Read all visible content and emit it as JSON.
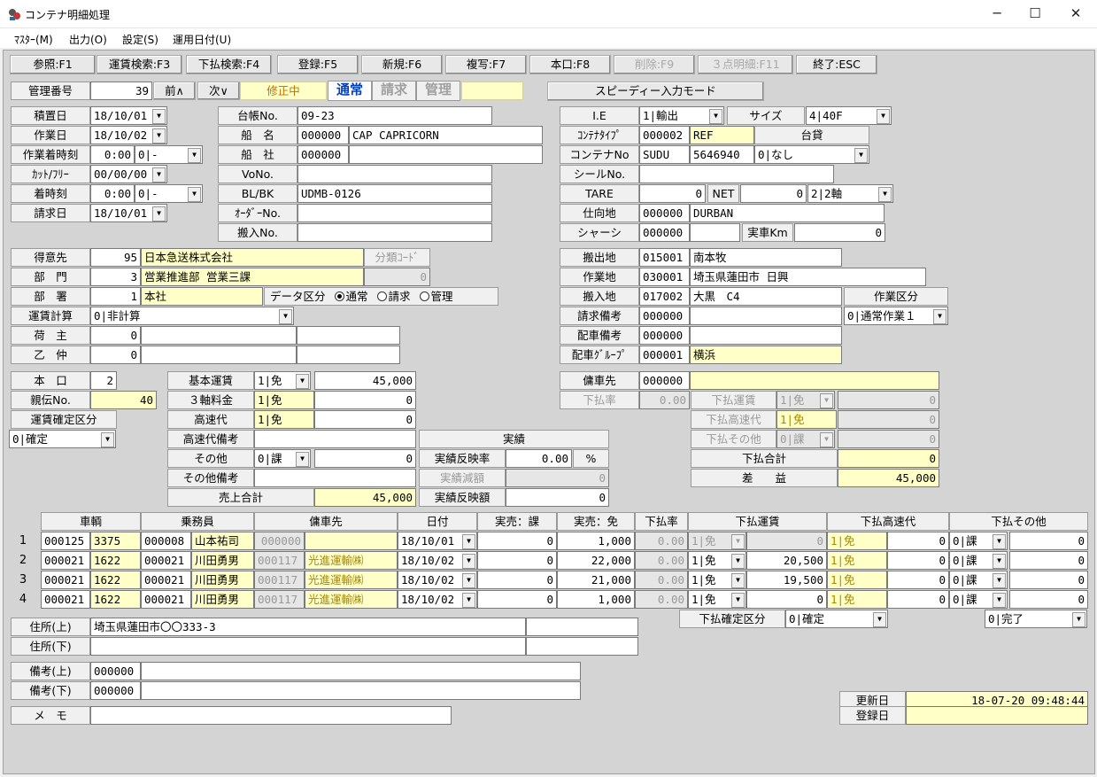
{
  "window": {
    "title": "コンテナ明細処理",
    "minimize": "─",
    "maximize": "☐",
    "close": "✕"
  },
  "menu": [
    "ﾏｽﾀｰ(M)",
    "出力(O)",
    "設定(S)",
    "運用日付(U)"
  ],
  "toolbar": [
    "参照:F1",
    "運賃検索:F3",
    "下払検索:F4",
    "登録:F5",
    "新規:F6",
    "複写:F7",
    "本口:F8",
    "削除:F9",
    "３点明細:F11",
    "終了:ESC"
  ],
  "header": {
    "kanri_label": "管理番号",
    "kanri_no": "39",
    "prev": "前∧",
    "next": "次∨",
    "status": "修正中",
    "mode_normal": "通常",
    "mode_seikyu": "請求",
    "mode_kanri": "管理",
    "speedy": "スピーディー入力モード"
  },
  "left1": {
    "labels": [
      "積置日",
      "作業日",
      "作業着時刻",
      "ｶｯﾄ/ﾌﾘｰ",
      "着時刻",
      "請求日"
    ],
    "tsumioki": "18/10/01",
    "sagyo": "18/10/02",
    "sagyo_time": "0:00",
    "sagyo_time_opt": "0|-",
    "cut": "00/00/00",
    "chaku_time": "0:00",
    "chaku_opt": "0|-",
    "seikyu": "18/10/01"
  },
  "mid1": {
    "labels": [
      "台帳No.",
      "船　名",
      "船　社",
      "VoNo.",
      "BL/BK",
      "ｵｰﾀﾞｰNo.",
      "搬入No."
    ],
    "daicho": "09-23",
    "senmei_code": "000000",
    "senmei": "CAP CAPRICORN",
    "sensha_code": "000000",
    "blbk": "UDMB-0126"
  },
  "right1": {
    "ie_label": "I.E",
    "ie": "1|輸出",
    "size_label": "サイズ",
    "size": "4|40F",
    "type_label": "ｺﾝﾃﾅﾀｲﾌﾟ",
    "type_code": "000002",
    "type": "REF",
    "daikashi": "台貸",
    "no_label": "コンテナNo",
    "prefix": "SUDU",
    "number": "5646940",
    "nashi": "0|なし",
    "seal_label": "シールNo.",
    "tare_label": "TARE",
    "tare": "0",
    "net_label": "NET",
    "net": "0",
    "axle": "2|2軸",
    "shimuke_label": "仕向地",
    "shimuke_code": "000000",
    "shimuke": "DURBAN",
    "chassis_label": "シャーシ",
    "chassis_code": "000000",
    "jissha_label": "実車Km",
    "jissha": "0"
  },
  "tokui": {
    "labels": [
      "得意先",
      "部　門",
      "部　署",
      "運賃計算",
      "荷　主",
      "乙　仲"
    ],
    "tokui_code": "95",
    "tokui_name": "日本急送株式会社",
    "bunrui": "分類ｺｰﾄﾞ",
    "bunrui_val": "0",
    "bumon_code": "3",
    "bumon_name": "営業推進部 営業三課",
    "busho_code": "1",
    "busho_name": "本社",
    "data_kubun": "データ区分",
    "r1": "通常",
    "r2": "請求",
    "r3": "管理",
    "unchin": "0|非計算",
    "ninushi": "0",
    "otsunaka": "0"
  },
  "hanshutsu": {
    "labels": [
      "搬出地",
      "作業地",
      "搬入地",
      "請求備考",
      "配車備考",
      "配車ｸﾞﾙｰﾌﾟ"
    ],
    "c1": "015001",
    "n1": "南本牧",
    "c2": "030001",
    "n2": "埼玉県蓮田市 日興",
    "c3": "017002",
    "n3": "大黒　C4",
    "c4": "000000",
    "c5": "000000",
    "c6": "000001",
    "n6": "横浜",
    "sagyo_kubun_label": "作業区分",
    "sagyo_kubun": "0|通常作業１"
  },
  "honkuchi": {
    "label": "本　口",
    "val": "2",
    "oya_label": "親伝No.",
    "oya": "40",
    "kakutei_label": "運賃確定区分",
    "kakutei": "0|確定"
  },
  "unchin": {
    "labels": [
      "基本運賃",
      "３軸料金",
      "高速代",
      "高速代備考",
      "その他",
      "その他備考",
      "売上合計"
    ],
    "kihon_opt": "1|免",
    "kihon": "45,000",
    "sanjiku_opt": "1|免",
    "sanjiku": "0",
    "kosoku_opt": "1|免",
    "kosoku": "0",
    "sonota_opt": "0|課",
    "sonota": "0",
    "uriage": "45,000"
  },
  "jisseki": {
    "title": "実績",
    "ritsu_label": "実績反映率",
    "ritsu": "0.00",
    "pct": "%",
    "gengaku_label": "実績減額",
    "gengaku": "0",
    "hanei_label": "実績反映額",
    "hanei": "0"
  },
  "yosha": {
    "label": "傭車先",
    "code": "000000",
    "shita_ritsu_label": "下払率",
    "shita_ritsu": "0.00",
    "labels": [
      "下払運賃",
      "下払高速代",
      "下払その他",
      "下払合計",
      "差　　益"
    ],
    "o1": "1|免",
    "v1": "0",
    "o2": "1|免",
    "v2": "0",
    "o3": "0|課",
    "v3": "0",
    "gokei": "0",
    "saeki": "45,000"
  },
  "grid": {
    "headers": [
      "車輌",
      "乗務員",
      "傭車先",
      "日付",
      "実売：課",
      "実売：免",
      "下払率",
      "下払運賃",
      "下払高速代",
      "下払その他"
    ],
    "rows": [
      {
        "no": "1",
        "sc": "000125",
        "sn": "3375",
        "jc": "000008",
        "jn": "山本祐司",
        "yc": "000000",
        "yn": "",
        "date": "18/10/01",
        "ka": "0",
        "men": "1,000",
        "ritsu": "0.00",
        "uo": "1|免",
        "uv": "0",
        "ko": "1|免",
        "kv": "0",
        "so": "0|課",
        "sv": "0"
      },
      {
        "no": "2",
        "sc": "000021",
        "sn": "1622",
        "jc": "000021",
        "jn": "川田勇男",
        "yc": "000117",
        "yn": "光進運輸㈱",
        "date": "18/10/02",
        "ka": "0",
        "men": "22,000",
        "ritsu": "0.00",
        "uo": "1|免",
        "uv": "20,500",
        "ko": "1|免",
        "kv": "0",
        "so": "0|課",
        "sv": "0"
      },
      {
        "no": "3",
        "sc": "000021",
        "sn": "1622",
        "jc": "000021",
        "jn": "川田勇男",
        "yc": "000117",
        "yn": "光進運輸㈱",
        "date": "18/10/02",
        "ka": "0",
        "men": "21,000",
        "ritsu": "0.00",
        "uo": "1|免",
        "uv": "19,500",
        "ko": "1|免",
        "kv": "0",
        "so": "0|課",
        "sv": "0"
      },
      {
        "no": "4",
        "sc": "000021",
        "sn": "1622",
        "jc": "000021",
        "jn": "川田勇男",
        "yc": "000117",
        "yn": "光進運輸㈱",
        "date": "18/10/02",
        "ka": "0",
        "men": "1,000",
        "ritsu": "0.00",
        "uo": "1|免",
        "uv": "0",
        "ko": "1|免",
        "kv": "0",
        "so": "0|課",
        "sv": "0"
      }
    ]
  },
  "shita_kakutei": {
    "label": "下払確定区分",
    "val": "0|確定",
    "kanryo": "0|完了"
  },
  "address": {
    "ue_label": "住所(上)",
    "ue": "埼玉県蓮田市〇〇333-3",
    "shita_label": "住所(下)"
  },
  "biko": {
    "ue_label": "備考(上)",
    "ue_code": "000000",
    "shita_label": "備考(下)",
    "shita_code": "000000",
    "memo_label": "メ　モ"
  },
  "update": {
    "koshin_label": "更新日",
    "koshin": "18-07-20 09:48:44",
    "toroku_label": "登録日"
  }
}
